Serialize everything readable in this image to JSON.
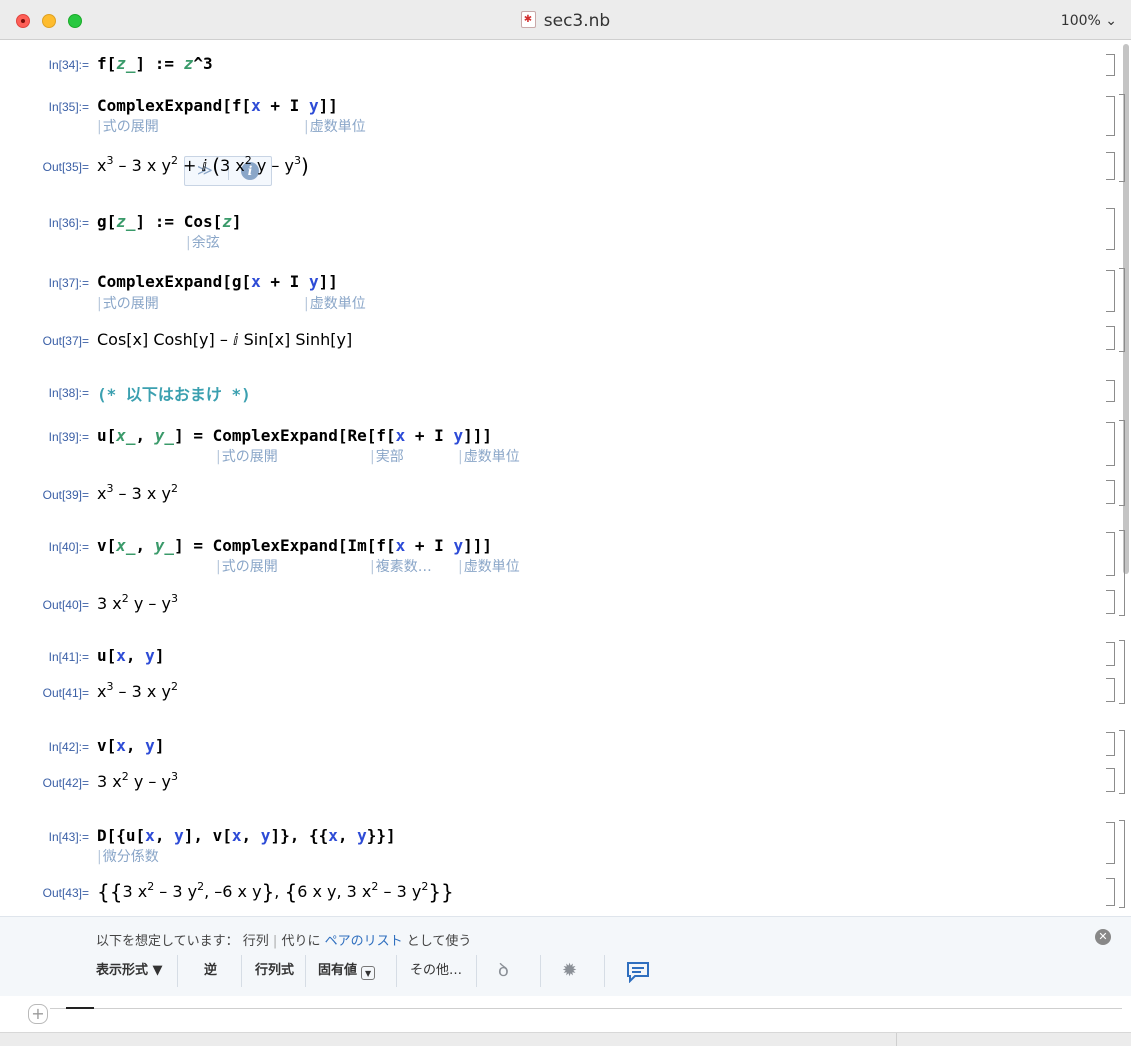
{
  "window": {
    "title": "sec3.nb",
    "zoom": "100% ⌄"
  },
  "cells": {
    "in34": {
      "label": "In[34]:="
    },
    "in35": {
      "label": "In[35]:=",
      "hint1": "式の展開",
      "hint2": "虚数単位"
    },
    "out35": {
      "label": "Out[35]="
    },
    "in36": {
      "label": "In[36]:=",
      "hint1": "余弦"
    },
    "in37": {
      "label": "In[37]:=",
      "hint1": "式の展開",
      "hint2": "虚数単位"
    },
    "out37": {
      "label": "Out[37]=",
      "text": "Cos[x] Cosh[y] – ⅈ Sin[x] Sinh[y]"
    },
    "in38": {
      "label": "In[38]:="
    },
    "in39": {
      "label": "In[39]:=",
      "hint1": "式の展開",
      "hint2": "実部",
      "hint3": "虚数単位"
    },
    "out39": {
      "label": "Out[39]="
    },
    "in40": {
      "label": "In[40]:=",
      "hint1": "式の展開",
      "hint2": "複素数…",
      "hint3": "虚数単位"
    },
    "out40": {
      "label": "Out[40]="
    },
    "in41": {
      "label": "In[41]:="
    },
    "out41": {
      "label": "Out[41]="
    },
    "in42": {
      "label": "In[42]:="
    },
    "out42": {
      "label": "Out[42]="
    },
    "in43": {
      "label": "In[43]:=",
      "hint1": "微分係数"
    },
    "out43": {
      "label": "Out[43]="
    }
  },
  "code_text": {
    "f_def": "f[z_] := z^3",
    "complexexpand_f": "ComplexExpand[f[x + I y]]",
    "g_def": "g[z_] := Cos[z]",
    "complexexpand_g": "ComplexExpand[g[x + I y]]",
    "comment": "(* 以下はおまけ *)",
    "u_def": "u[x_, y_] = ComplexExpand[Re[f[x + I y]]]",
    "v_def": "v[x_, y_] = ComplexExpand[Im[f[x + I y]]]",
    "u_call": "u[x, y]",
    "v_call": "v[x, y]",
    "jacobian": "D[{u[x, y], v[x, y]}, {{x, y}}]"
  },
  "assistant": {
    "assume_prefix": "以下を想定しています：",
    "assume_matrix": "行列",
    "assume_sep": "|",
    "assume_instead": "代りに",
    "assume_link": "ペアのリスト",
    "assume_suffix": "として使う",
    "format_label": "表示形式 ▼",
    "inverse": "逆",
    "determinant": "行列式",
    "eigenvalues": "固有値",
    "more": "その他…"
  },
  "icons": [
    "close-icon",
    "chevron-double-down-icon",
    "info-icon",
    "swirl-icon",
    "gear-icon",
    "feedback-icon",
    "add-cell-icon"
  ]
}
